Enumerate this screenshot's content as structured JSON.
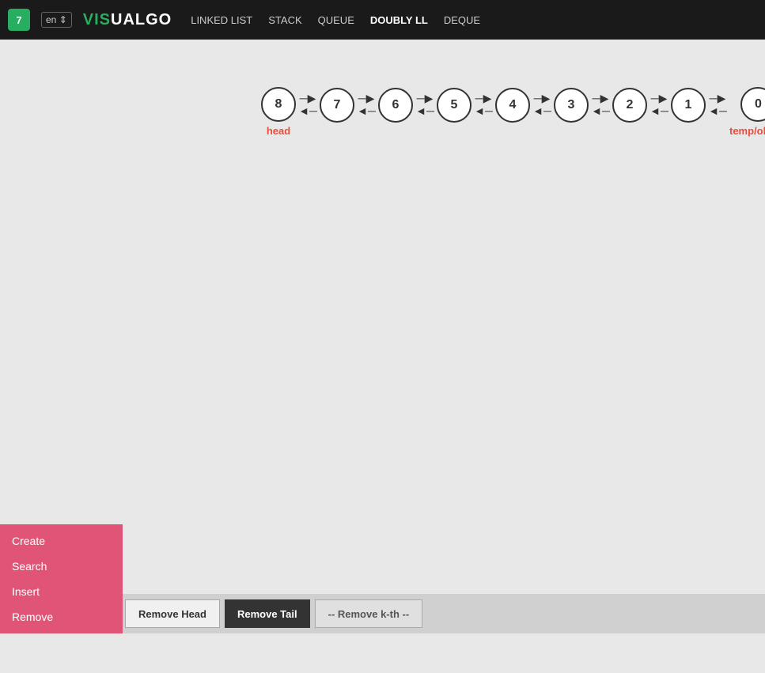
{
  "navbar": {
    "logo_text": "7",
    "lang": "en",
    "brand_vis": "VIS",
    "brand_ualgo": "UALGO",
    "nav_items": [
      {
        "label": "LINKED LIST",
        "active": false
      },
      {
        "label": "STACK",
        "active": false
      },
      {
        "label": "QUEUE",
        "active": false
      },
      {
        "label": "DOUBLY LL",
        "active": true
      },
      {
        "label": "DEQUE",
        "active": false
      }
    ]
  },
  "list": {
    "nodes": [
      {
        "value": "8",
        "label": "head"
      },
      {
        "value": "7",
        "label": ""
      },
      {
        "value": "6",
        "label": ""
      },
      {
        "value": "5",
        "label": ""
      },
      {
        "value": "4",
        "label": ""
      },
      {
        "value": "3",
        "label": ""
      },
      {
        "value": "2",
        "label": ""
      },
      {
        "value": "1",
        "label": ""
      },
      {
        "value": "0",
        "label": "temp/oldtail"
      }
    ]
  },
  "left_panel": {
    "items": [
      {
        "label": "Create"
      },
      {
        "label": "Search"
      },
      {
        "label": "Insert"
      },
      {
        "label": "Remove"
      }
    ]
  },
  "action_bar": {
    "buttons": [
      {
        "label": "Remove Head",
        "style": "light"
      },
      {
        "label": "Remove Tail",
        "style": "dark"
      },
      {
        "label": "-- Remove k-th --",
        "style": "outline"
      }
    ]
  }
}
